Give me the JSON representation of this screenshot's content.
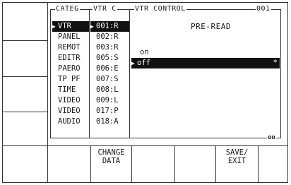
{
  "screen": {
    "categories": {
      "caption": "CATEG",
      "items": [
        {
          "label": "VTR",
          "selected": true
        },
        {
          "label": "PANEL",
          "selected": false
        },
        {
          "label": "REMOT",
          "selected": false
        },
        {
          "label": "EDITR",
          "selected": false
        },
        {
          "label": "PAERO",
          "selected": false
        },
        {
          "label": "TP PF",
          "selected": false
        },
        {
          "label": "TIME",
          "selected": false
        },
        {
          "label": "VIDEO",
          "selected": false
        },
        {
          "label": "VIDEO",
          "selected": false
        },
        {
          "label": "AUDIO",
          "selected": false
        }
      ]
    },
    "vtr_list": {
      "caption": "VTR C",
      "items": [
        {
          "label": "001:R",
          "selected": true
        },
        {
          "label": "002:R",
          "selected": false
        },
        {
          "label": "003:R",
          "selected": false
        },
        {
          "label": "005:S",
          "selected": false
        },
        {
          "label": "006:E",
          "selected": false
        },
        {
          "label": "007:S",
          "selected": false
        },
        {
          "label": "008:L",
          "selected": false
        },
        {
          "label": "009:L",
          "selected": false
        },
        {
          "label": "017:P",
          "selected": false
        },
        {
          "label": "018:A",
          "selected": false
        }
      ]
    },
    "control": {
      "caption": "VTR CONTROL",
      "number": "001",
      "parameter": "PRE-READ",
      "options": [
        {
          "label": "on",
          "selected": false
        },
        {
          "label": "off",
          "selected": true,
          "marker": "*"
        }
      ]
    },
    "scroll_indicator": "oo"
  },
  "softkeys": [
    {
      "line1": "",
      "line2": ""
    },
    {
      "line1": "",
      "line2": ""
    },
    {
      "line1": "CHANGE",
      "line2": "DATA"
    },
    {
      "line1": "",
      "line2": ""
    },
    {
      "line1": "SAVE/",
      "line2": "EXIT"
    },
    {
      "line1": "",
      "line2": ""
    }
  ]
}
